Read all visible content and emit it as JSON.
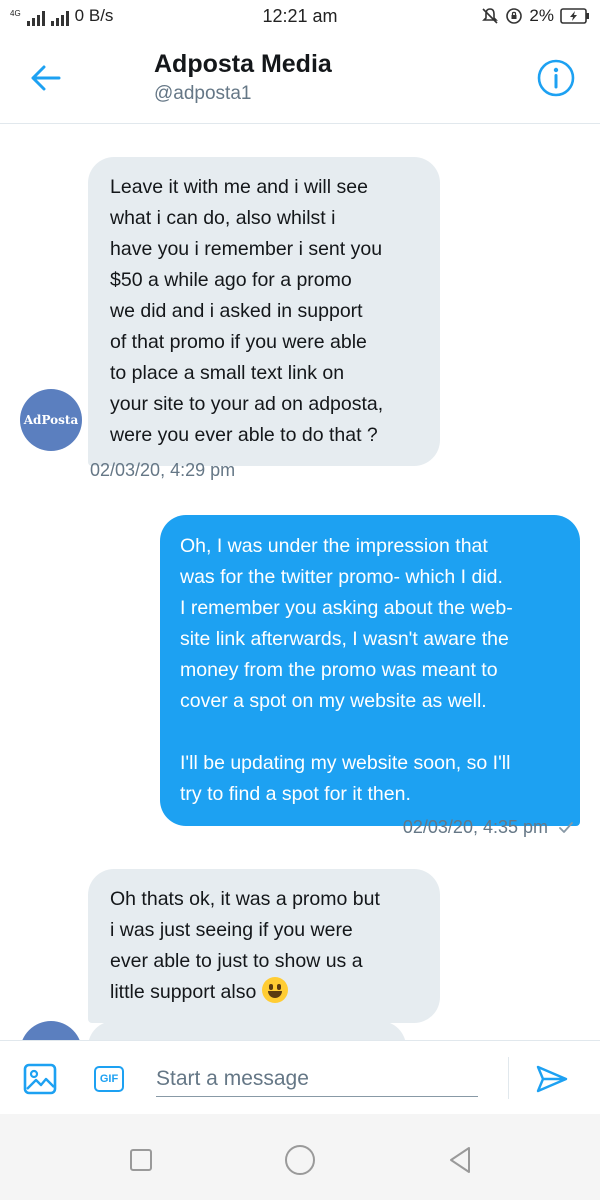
{
  "status_bar": {
    "network_type": "4G",
    "data_speed": "0 B/s",
    "time": "12:21 am",
    "battery": "2%"
  },
  "header": {
    "name": "Adposta Media",
    "handle": "@adposta1"
  },
  "avatar": {
    "text": "AdPosta"
  },
  "messages": [
    {
      "direction": "incoming",
      "lines": [
        "Leave it with me and i will see",
        "what i can do, also whilst i",
        "have you i remember i sent you",
        "$50 a while ago for a promo",
        "we did and i asked in support",
        "of that promo if you were able",
        "to place a small text link on",
        "your site to your ad on adposta,",
        "were you ever able to do that ?"
      ],
      "timestamp": "02/03/20, 4:29 pm"
    },
    {
      "direction": "outgoing",
      "lines": [
        "Oh, I was under the impression that",
        "was for the twitter promo- which I did.",
        "I remember you asking about the web-",
        "site link afterwards, I wasn't aware the",
        "money from the promo was meant to",
        "cover a spot on my website as well.",
        "",
        "I'll be updating my website soon, so I'll",
        "try to find a spot for it then."
      ],
      "timestamp": "02/03/20, 4:35 pm"
    },
    {
      "direction": "incoming",
      "lines": [
        "Oh thats ok, it was a promo but",
        "i was just seeing if you were",
        "ever able to just to show us a",
        "little support also"
      ],
      "emoji": "grinning-face"
    }
  ],
  "composer": {
    "placeholder": "Start a message",
    "gif_label": "GIF"
  },
  "colors": {
    "accent": "#1da1f2",
    "incoming_bubble": "#e6ecf0",
    "text_secondary": "#657786"
  }
}
